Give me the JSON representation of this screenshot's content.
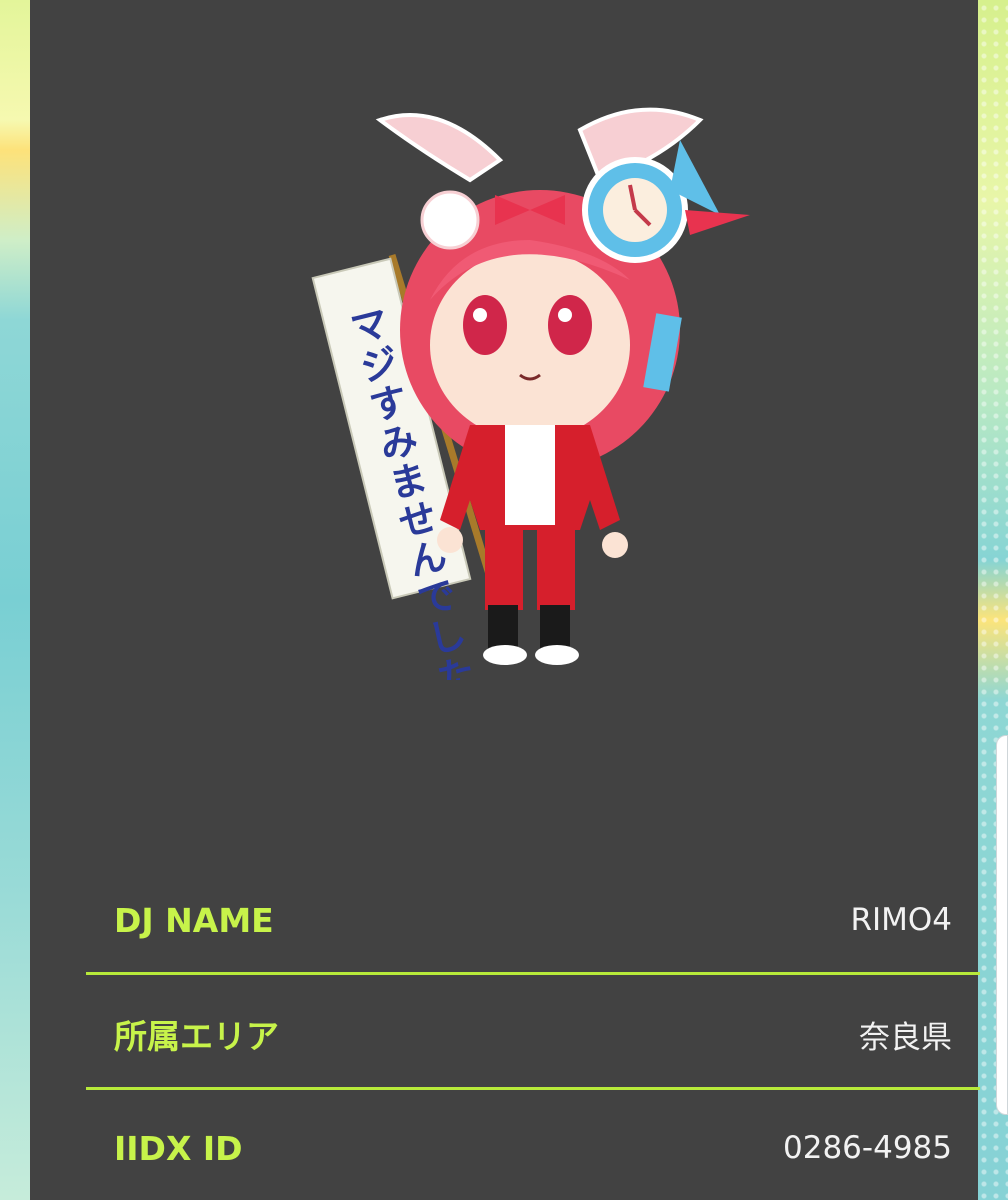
{
  "colors": {
    "panel_bg": "#424242",
    "label_green": "#c7f34a",
    "divider_green": "#b7ea3a",
    "value_text": "#f2f2f2"
  },
  "avatar": {
    "icon": "chibi-character-avatar",
    "sign_text": "マジすみませんでした"
  },
  "profile": {
    "rows": [
      {
        "label": "DJ NAME",
        "value": "RIMO4"
      },
      {
        "label": "所属エリア",
        "value": "奈良県"
      },
      {
        "label": "IIDX ID",
        "value": "0286-4985"
      }
    ]
  }
}
